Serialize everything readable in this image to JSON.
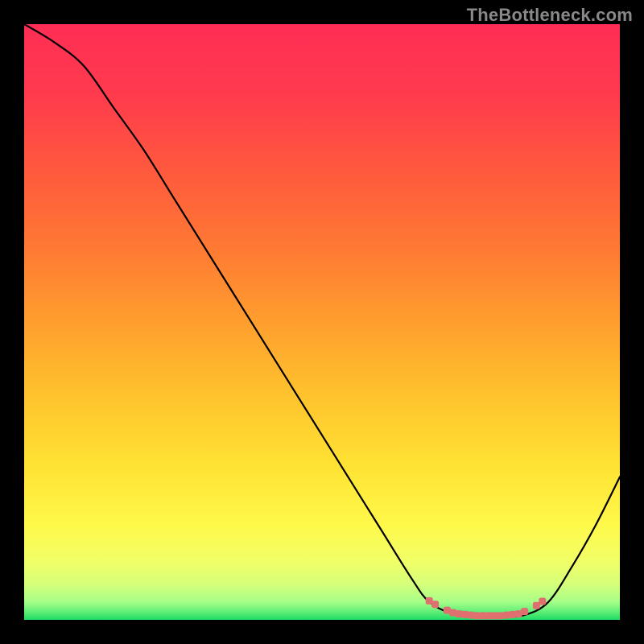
{
  "watermark": "TheBottleneck.com",
  "chart_data": {
    "type": "line",
    "title": "",
    "xlabel": "",
    "ylabel": "",
    "xlim": [
      0,
      100
    ],
    "ylim": [
      0,
      100
    ],
    "grid": false,
    "legend": false,
    "series": [
      {
        "name": "bottleneck-curve",
        "color": "#000000",
        "x": [
          0,
          5,
          10,
          15,
          20,
          25,
          30,
          35,
          40,
          45,
          50,
          55,
          60,
          65,
          68,
          72,
          76,
          80,
          84,
          88,
          92,
          96,
          100
        ],
        "values": [
          100,
          97,
          93,
          86,
          79,
          71,
          63,
          55,
          47,
          39,
          31,
          23,
          15,
          7,
          3,
          1,
          0.5,
          0.5,
          0.8,
          3,
          9,
          16,
          24
        ]
      },
      {
        "name": "marker-band",
        "color": "#e07070",
        "type": "scatter",
        "x": [
          68,
          69,
          71,
          72,
          73,
          74,
          75,
          76,
          77,
          78,
          79,
          80,
          81,
          82,
          83,
          84,
          86,
          87
        ],
        "values": [
          3.2,
          2.6,
          1.6,
          1.2,
          1.0,
          0.9,
          0.8,
          0.7,
          0.7,
          0.7,
          0.7,
          0.7,
          0.8,
          0.9,
          1.0,
          1.4,
          2.4,
          3.1
        ]
      }
    ],
    "background_gradient": {
      "stops": [
        {
          "offset": 0.0,
          "color": "#ff2d55"
        },
        {
          "offset": 0.12,
          "color": "#ff3b4d"
        },
        {
          "offset": 0.25,
          "color": "#ff5a3d"
        },
        {
          "offset": 0.38,
          "color": "#ff7a33"
        },
        {
          "offset": 0.5,
          "color": "#ff9e2e"
        },
        {
          "offset": 0.62,
          "color": "#ffc22d"
        },
        {
          "offset": 0.74,
          "color": "#ffe233"
        },
        {
          "offset": 0.84,
          "color": "#fff94a"
        },
        {
          "offset": 0.9,
          "color": "#f2ff66"
        },
        {
          "offset": 0.94,
          "color": "#d6ff7a"
        },
        {
          "offset": 0.97,
          "color": "#a6ff88"
        },
        {
          "offset": 0.985,
          "color": "#66f07a"
        },
        {
          "offset": 1.0,
          "color": "#1edc64"
        }
      ]
    }
  }
}
